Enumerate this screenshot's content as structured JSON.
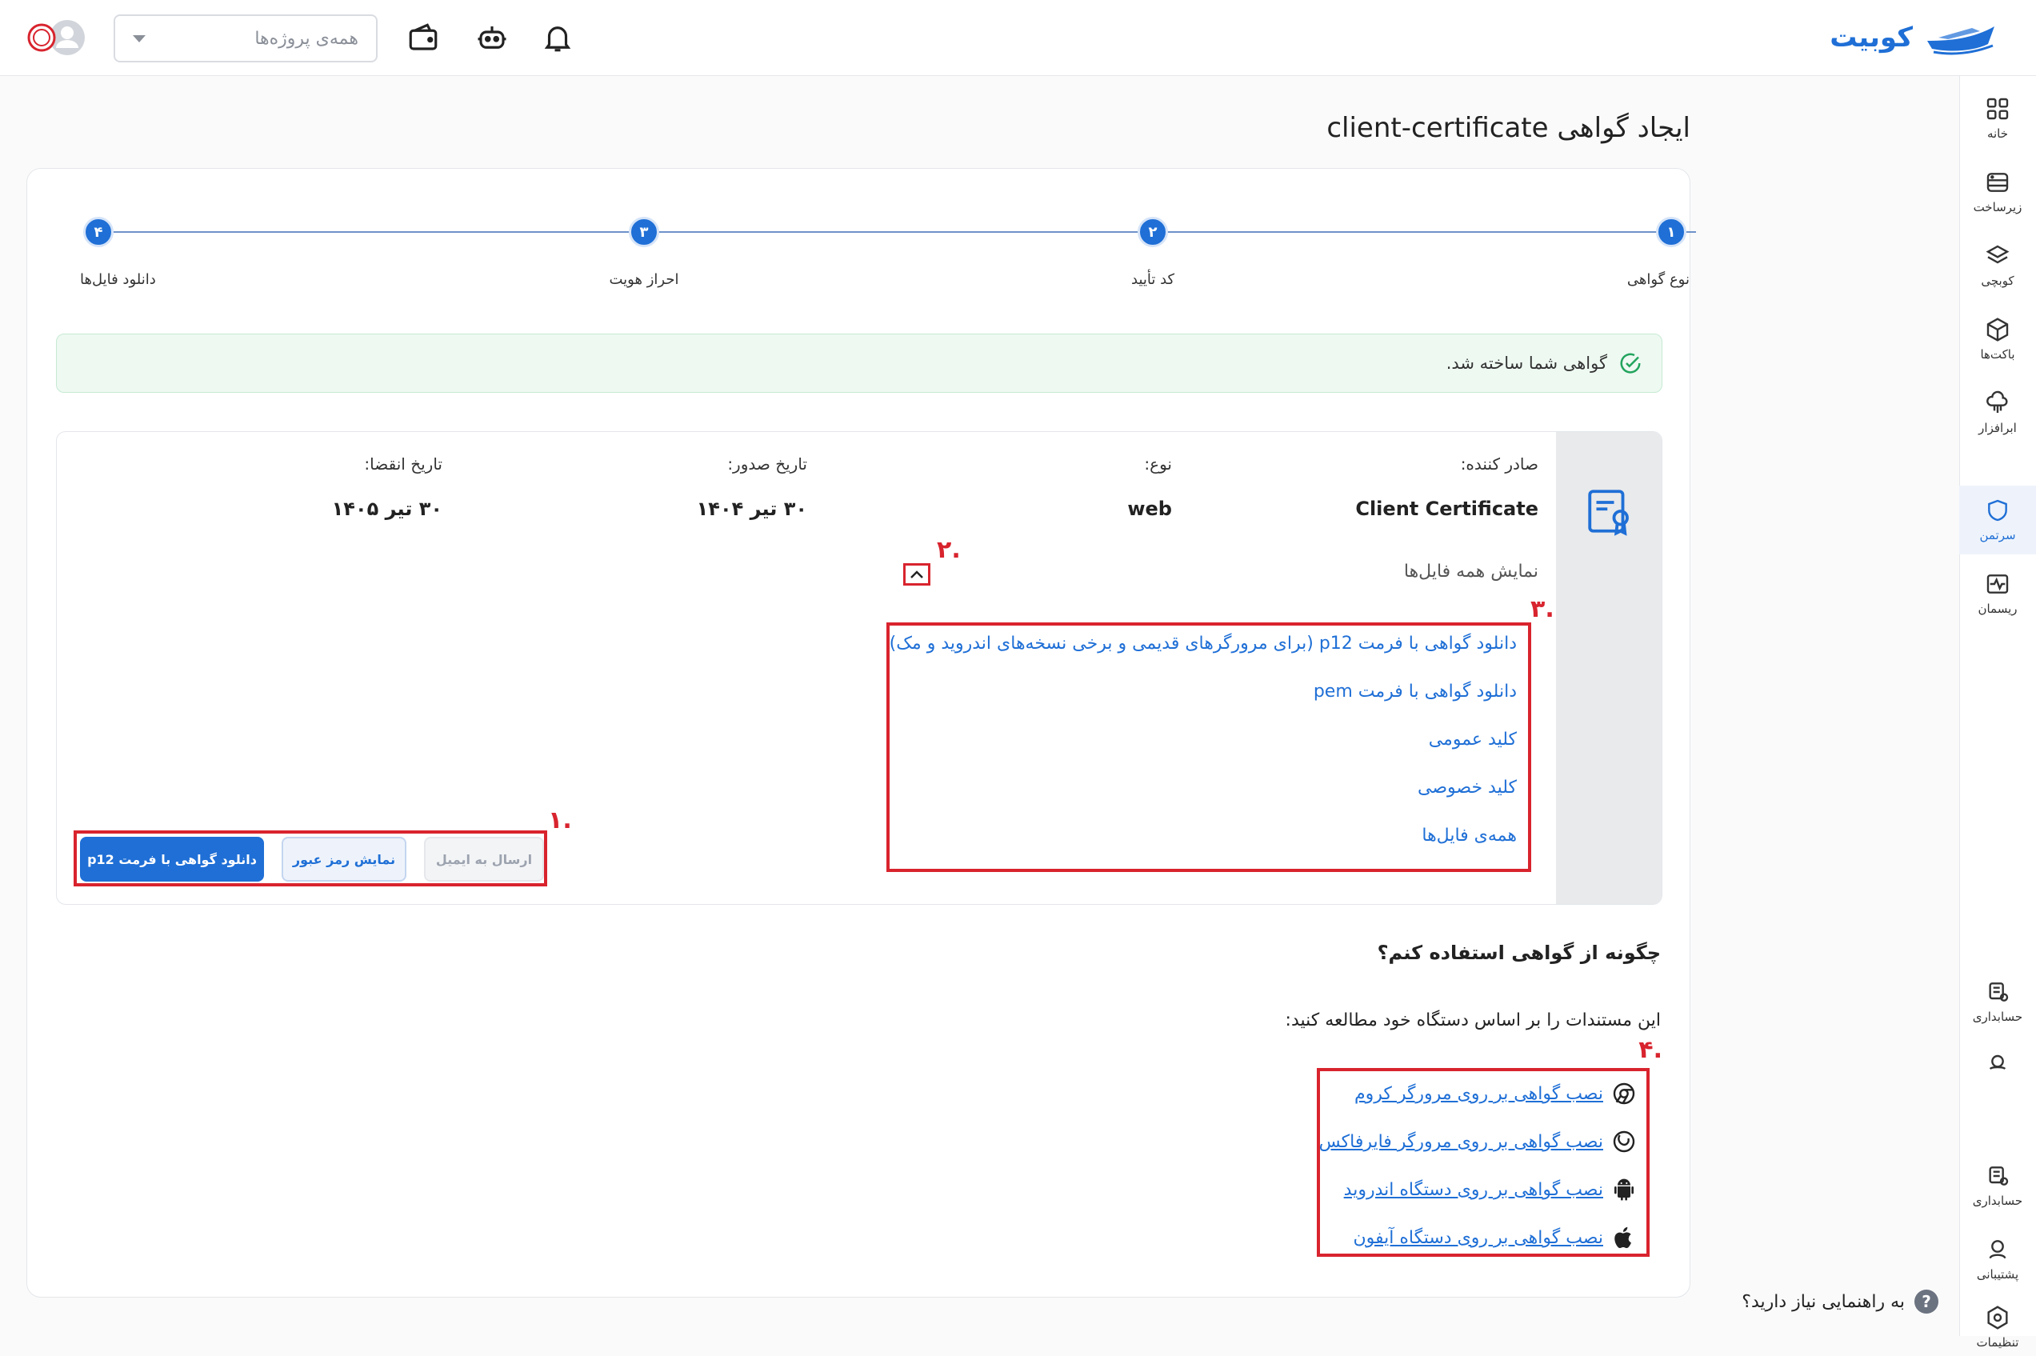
{
  "header": {
    "logo_text": "کوبیت",
    "project_select_placeholder": "همه‌ی پروژه‌ها"
  },
  "sidebar": {
    "items": [
      {
        "label": "خانه",
        "icon": "grid-icon"
      },
      {
        "label": "زیرساخت",
        "icon": "server-icon"
      },
      {
        "label": "کوبچی",
        "icon": "layers-icon"
      },
      {
        "label": "باکت‌ها",
        "icon": "cube-icon"
      },
      {
        "label": "ابرافزار",
        "icon": "cloud-app-icon"
      },
      {
        "label": "سرتمن",
        "icon": "shield-icon",
        "active": true
      },
      {
        "label": "ریسمان",
        "icon": "pulse-icon"
      }
    ],
    "bottom_items": [
      {
        "label": "حسابداری",
        "icon": "accounting-icon"
      },
      {
        "label": "",
        "icon": "support-icon"
      },
      {
        "label": "حسابداری",
        "icon": "accounting-icon"
      },
      {
        "label": "پشتیبانی",
        "icon": "headset-icon"
      },
      {
        "label": "تنظیمات",
        "icon": "settings-icon"
      }
    ],
    "help_text": "به راهنمایی نیاز دارید؟",
    "help_q": "?"
  },
  "page": {
    "title": "ایجاد گواهی client-certificate"
  },
  "stepper": {
    "steps": [
      {
        "num": "۱",
        "label": "نوع گواهی"
      },
      {
        "num": "۲",
        "label": "کد تأیید"
      },
      {
        "num": "۳",
        "label": "احراز هویت"
      },
      {
        "num": "۴",
        "label": "دانلود فایل‌ها"
      }
    ]
  },
  "success_message": "گواهی شما ساخته شد.",
  "certificate": {
    "issuer_label": "صادر کننده:",
    "issuer_value": "Client Certificate",
    "type_label": "نوع:",
    "type_value": "web",
    "issue_date_label": "تاریخ صدور:",
    "issue_date_value": "۳۰ تیر ۱۴۰۴",
    "expire_date_label": "تاریخ انقضا:",
    "expire_date_value": "۳۰ تیر ۱۴۰۵",
    "show_all_files": "نمایش همه فایل‌ها"
  },
  "downloads": [
    "دانلود گواهی با فرمت p12 (برای مرورگرهای قدیمی و برخی نسخه‌های اندروید و مک)",
    "دانلود گواهی با فرمت pem",
    "کلید عمومی",
    "کلید خصوصی",
    "همه‌ی فایل‌ها"
  ],
  "buttons": {
    "download_p12": "دانلود گواهی با فرمت p12",
    "show_password": "نمایش رمز عبور",
    "send_email": "ارسال به ایمیل"
  },
  "annotations": {
    "one": ".۱",
    "two": ".۲",
    "three": ".۳",
    "four": ".۴"
  },
  "howto": {
    "title": "چگونه از گواهی استفاده کنم؟",
    "desc": "این مستندات را بر اساس دستگاه خود مطالعه کنید:",
    "guides": [
      {
        "label": "نصب گواهی بر روی مرورگر کروم",
        "icon": "chrome-icon"
      },
      {
        "label": "نصب گواهی بر روی مرورگر فایرفاکس",
        "icon": "firefox-icon"
      },
      {
        "label": "نصب گواهی بر روی دستگاه اندروید",
        "icon": "android-icon"
      },
      {
        "label": "نصب گواهی بر روی دستگاه آیفون",
        "icon": "apple-icon"
      }
    ]
  },
  "colors": {
    "accent": "#1f6fd6",
    "annotation": "#d8242e",
    "success_bg": "#eef9f2"
  }
}
